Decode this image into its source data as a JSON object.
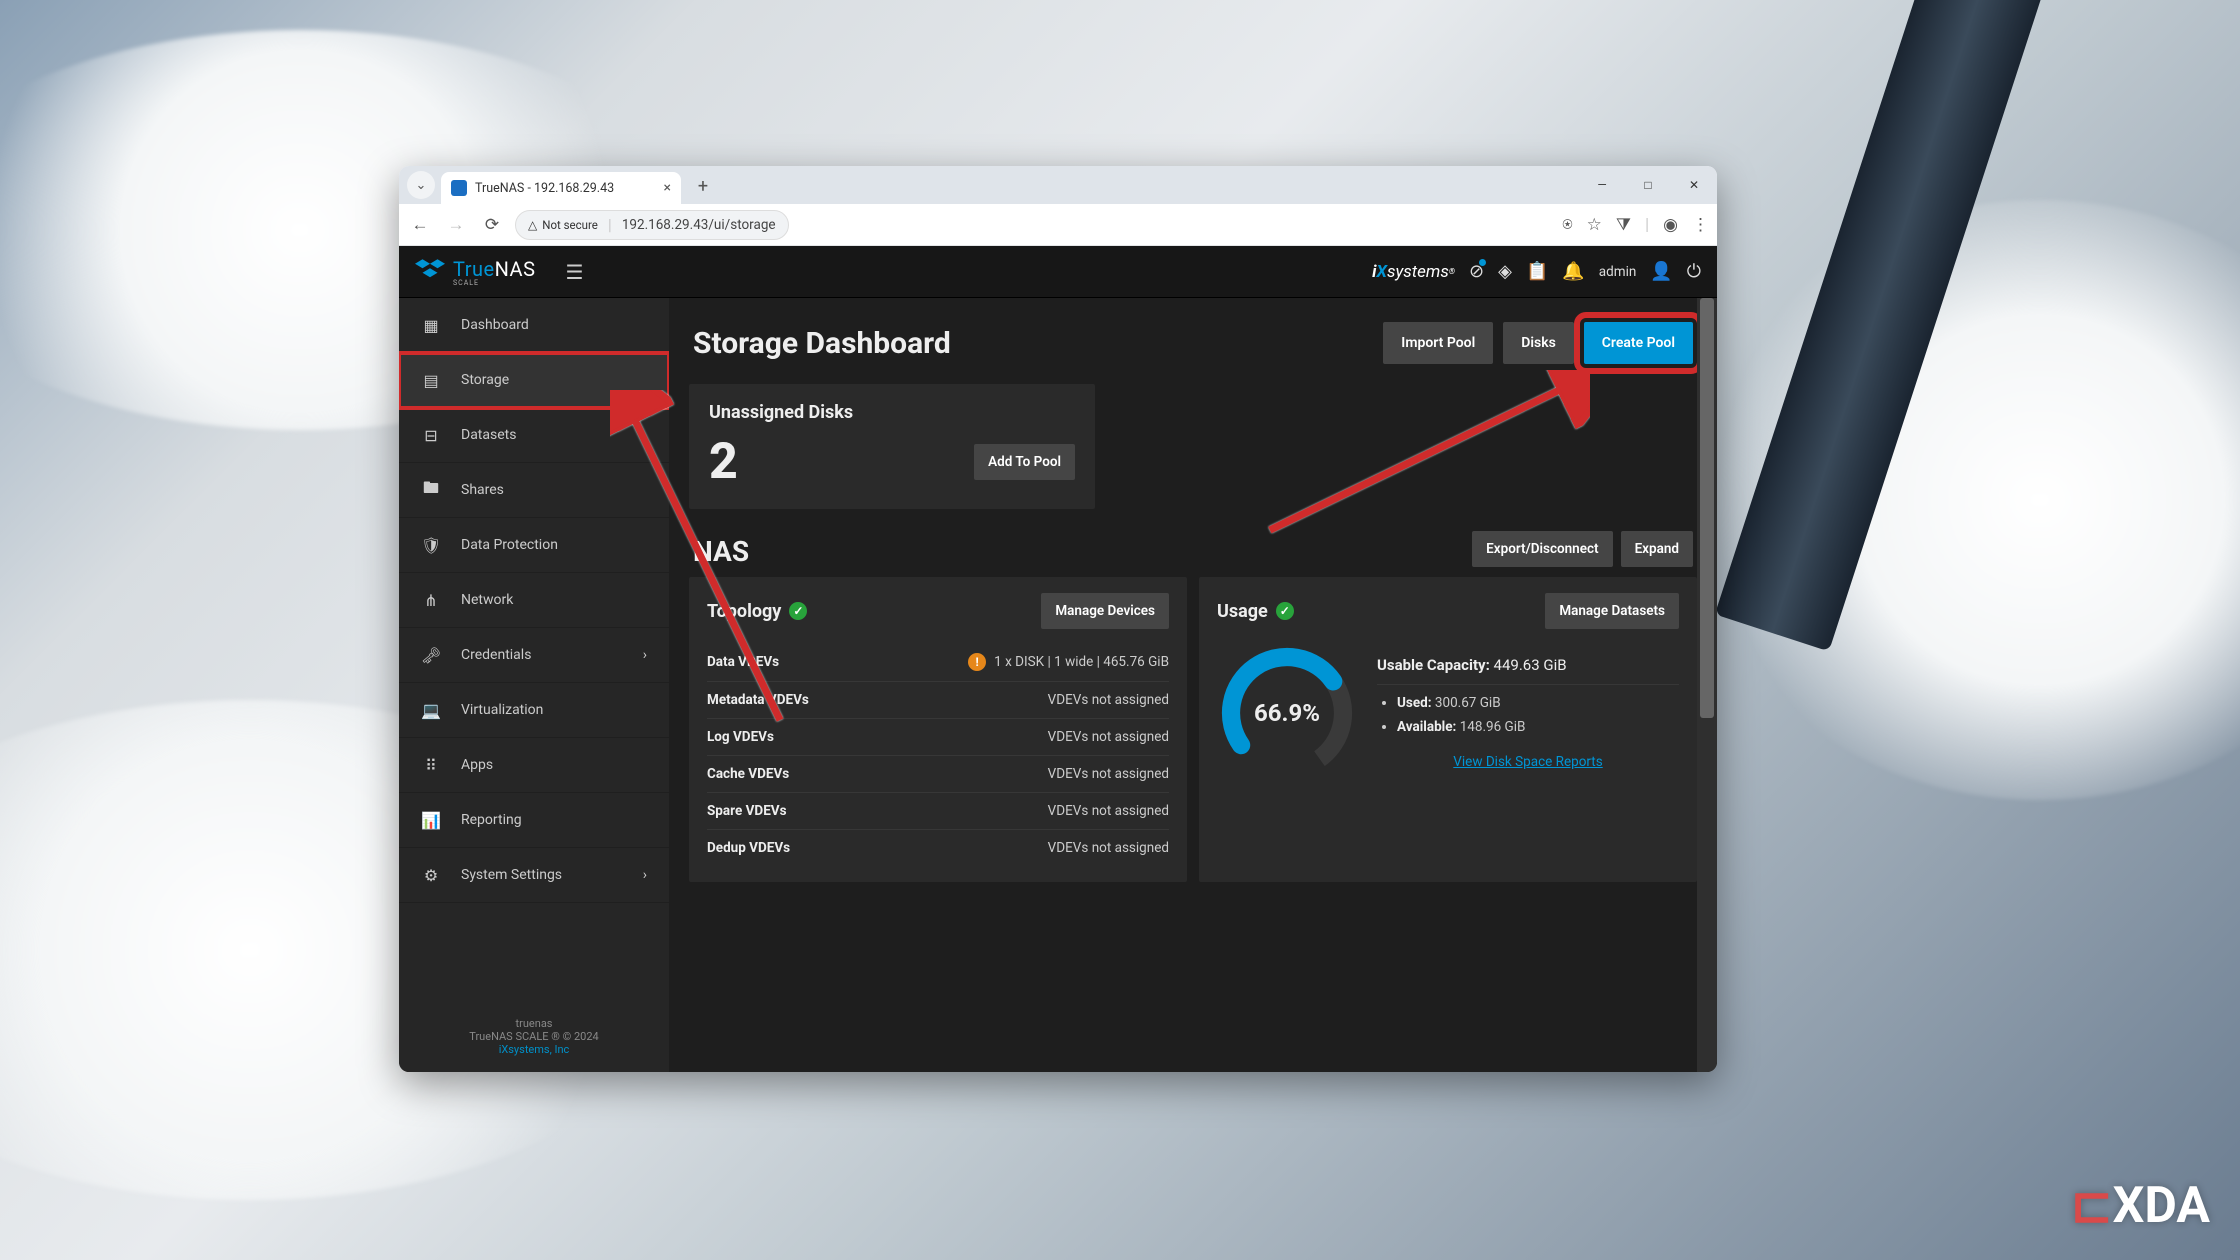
{
  "browser": {
    "tab_title": "TrueNAS - 192.168.29.43",
    "not_secure": "Not secure",
    "url": "192.168.29.43/ui/storage"
  },
  "header": {
    "brand": "TrueNAS",
    "brand_sub": "SCALE",
    "ix": "systems",
    "user": "admin"
  },
  "sidebar": {
    "items": [
      {
        "icon": "▦",
        "label": "Dashboard"
      },
      {
        "icon": "▤",
        "label": "Storage"
      },
      {
        "icon": "⊟",
        "label": "Datasets"
      },
      {
        "icon": "🖿",
        "label": "Shares"
      },
      {
        "icon": "🛡",
        "label": "Data Protection"
      },
      {
        "icon": "⋔",
        "label": "Network"
      },
      {
        "icon": "🔑",
        "label": "Credentials"
      },
      {
        "icon": "💻",
        "label": "Virtualization"
      },
      {
        "icon": "⠿",
        "label": "Apps"
      },
      {
        "icon": "📊",
        "label": "Reporting"
      },
      {
        "icon": "⚙",
        "label": "System Settings"
      }
    ],
    "footer1": "truenas",
    "footer2": "TrueNAS SCALE ® © 2024",
    "footer3": "iXsystems, Inc"
  },
  "page": {
    "title": "Storage Dashboard",
    "import": "Import Pool",
    "disks": "Disks",
    "create": "Create Pool"
  },
  "unassigned": {
    "title": "Unassigned Disks",
    "count": "2",
    "add": "Add To Pool"
  },
  "pool": {
    "name": "NAS",
    "export": "Export/Disconnect",
    "expand": "Expand"
  },
  "topology": {
    "title": "Topology",
    "manage": "Manage Devices",
    "rows": [
      {
        "k": "Data VDEVs",
        "v": "1 x DISK | 1 wide | 465.76 GiB",
        "warn": true
      },
      {
        "k": "Metadata VDEVs",
        "v": "VDEVs not assigned"
      },
      {
        "k": "Log VDEVs",
        "v": "VDEVs not assigned"
      },
      {
        "k": "Cache VDEVs",
        "v": "VDEVs not assigned"
      },
      {
        "k": "Spare VDEVs",
        "v": "VDEVs not assigned"
      },
      {
        "k": "Dedup VDEVs",
        "v": "VDEVs not assigned"
      }
    ]
  },
  "usage": {
    "title": "Usage",
    "manage": "Manage Datasets",
    "pct": "66.9%",
    "cap_label": "Usable Capacity:",
    "cap_value": "449.63 GiB",
    "used_label": "Used:",
    "used_value": "300.67 GiB",
    "avail_label": "Available:",
    "avail_value": "148.96 GiB",
    "link": "View Disk Space Reports"
  },
  "watermark": "XDA"
}
